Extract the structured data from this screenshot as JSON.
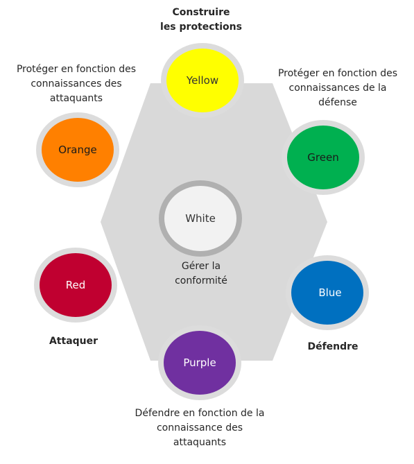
{
  "colors": {
    "hexagon": "#d9d9d9",
    "ring": "#dcdcdc",
    "yellow": "#ffff00",
    "green": "#00b050",
    "blue": "#0070c0",
    "purple": "#7030a0",
    "red": "#c00030",
    "orange": "#ff8000",
    "white_fill": "#f2f2f2",
    "white_ring": "#b0b0b0"
  },
  "nodes": {
    "yellow": {
      "label": "Yellow",
      "caption": "Construire\nles protections"
    },
    "green": {
      "label": "Green",
      "caption": "Protéger en fonction des\nconnaissances de la\ndéfense"
    },
    "blue": {
      "label": "Blue",
      "caption": "Défendre"
    },
    "purple": {
      "label": "Purple",
      "caption": "Défendre en fonction de la\nconnaissance des\nattaquants"
    },
    "red": {
      "label": "Red",
      "caption": "Attaquer"
    },
    "orange": {
      "label": "Orange",
      "caption": "Protéger en fonction des\nconnaissances des\nattaquants"
    },
    "white": {
      "label": "White",
      "caption": "Gérer la\nconformité"
    }
  }
}
